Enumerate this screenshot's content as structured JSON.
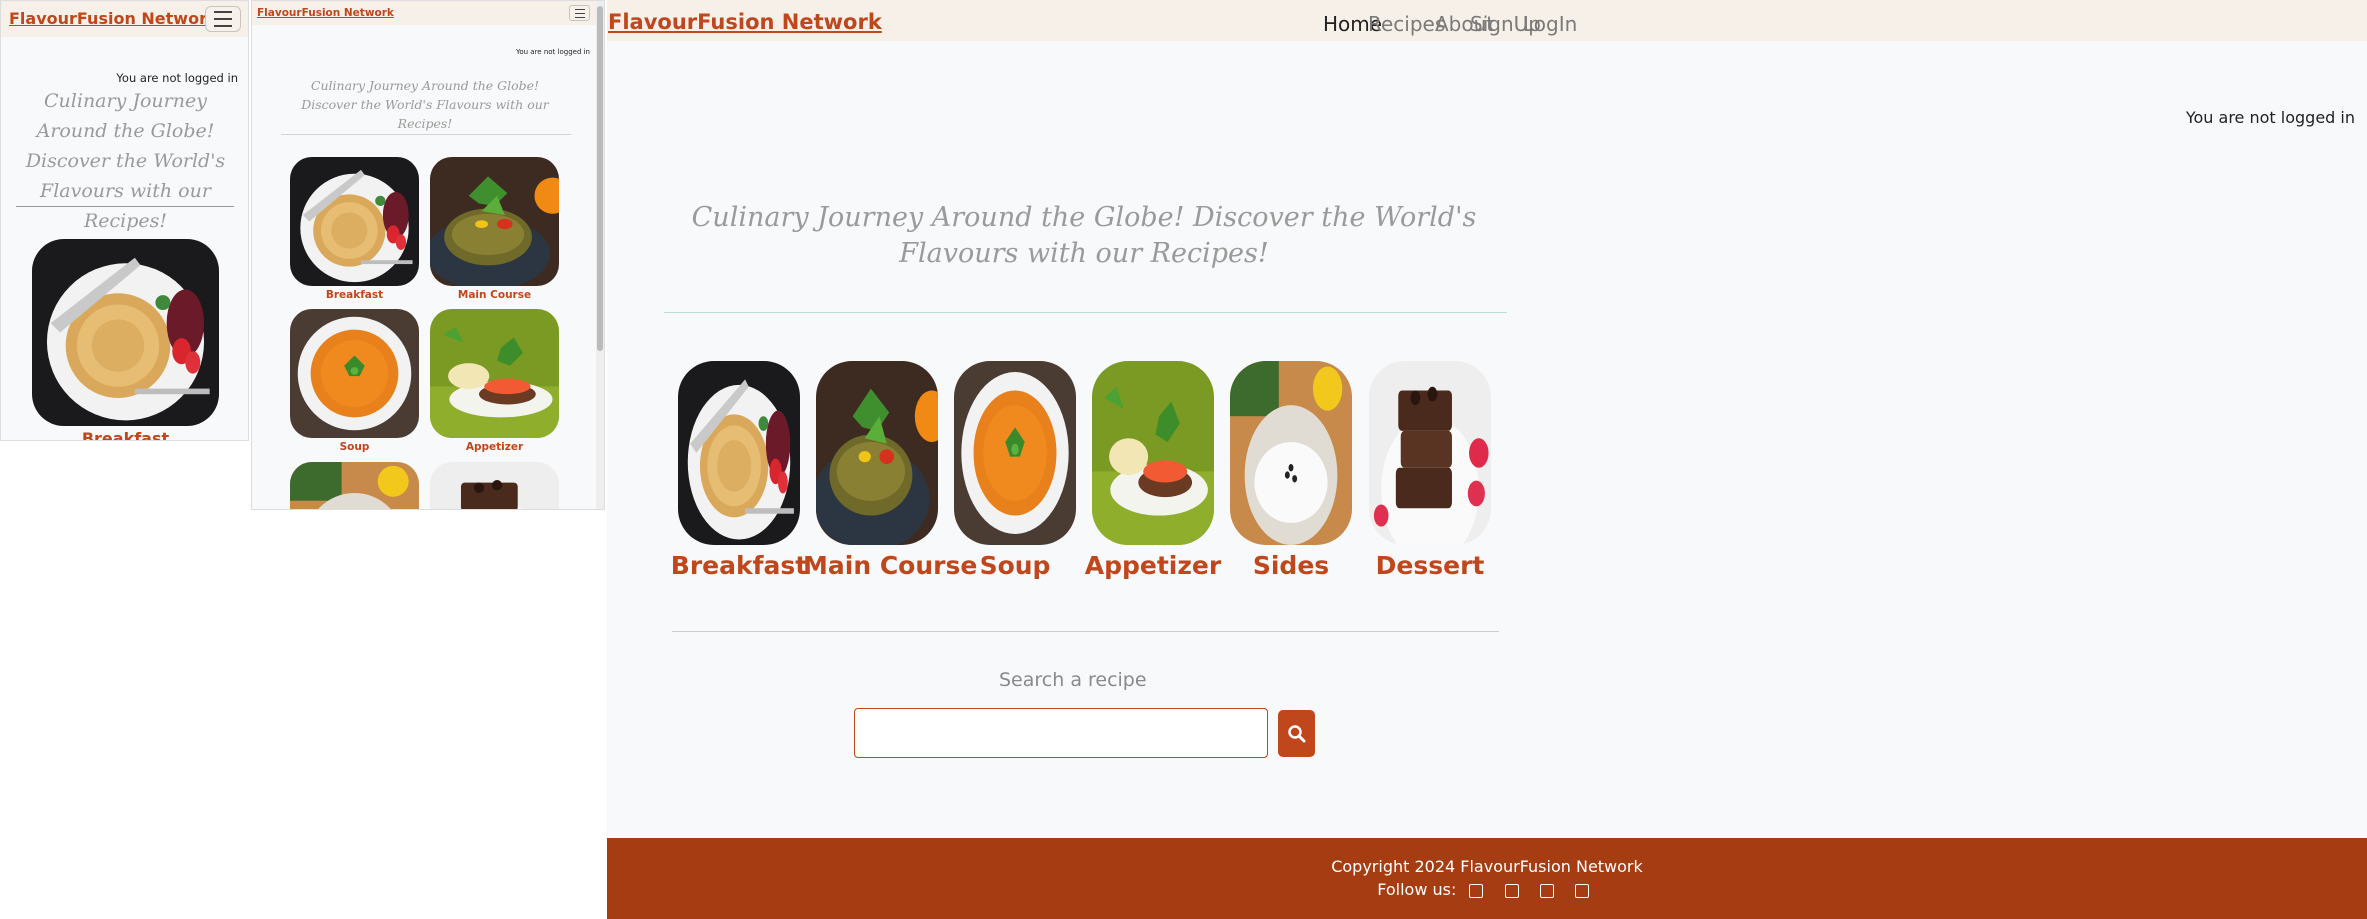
{
  "brand": "FlavourFusion Network",
  "login_status": "You are not logged in",
  "tagline": "Culinary Journey Around the Globe! Discover the World's Flavours with our Recipes!",
  "nav": {
    "home": "Home",
    "recipes": "Recipes",
    "about": "About",
    "signup": "SignUp",
    "login": "LogIn"
  },
  "categories": [
    "Breakfast",
    "Main Course",
    "Soup",
    "Appetizer",
    "Sides",
    "Dessert"
  ],
  "search": {
    "label": "Search a recipe",
    "placeholder": ""
  },
  "footer": {
    "copyright": "Copyright 2024 FlavourFusion Network",
    "follow": "Follow us:"
  },
  "icons": {
    "menu": "hamburger-icon",
    "search": "search-icon",
    "social": [
      "facebook-icon",
      "twitter-icon",
      "instagram-icon",
      "youtube-icon"
    ]
  },
  "colors": {
    "accent": "#c0461c",
    "footer_bg": "#a63d12",
    "navbar_bg": "#f6f0e8"
  }
}
